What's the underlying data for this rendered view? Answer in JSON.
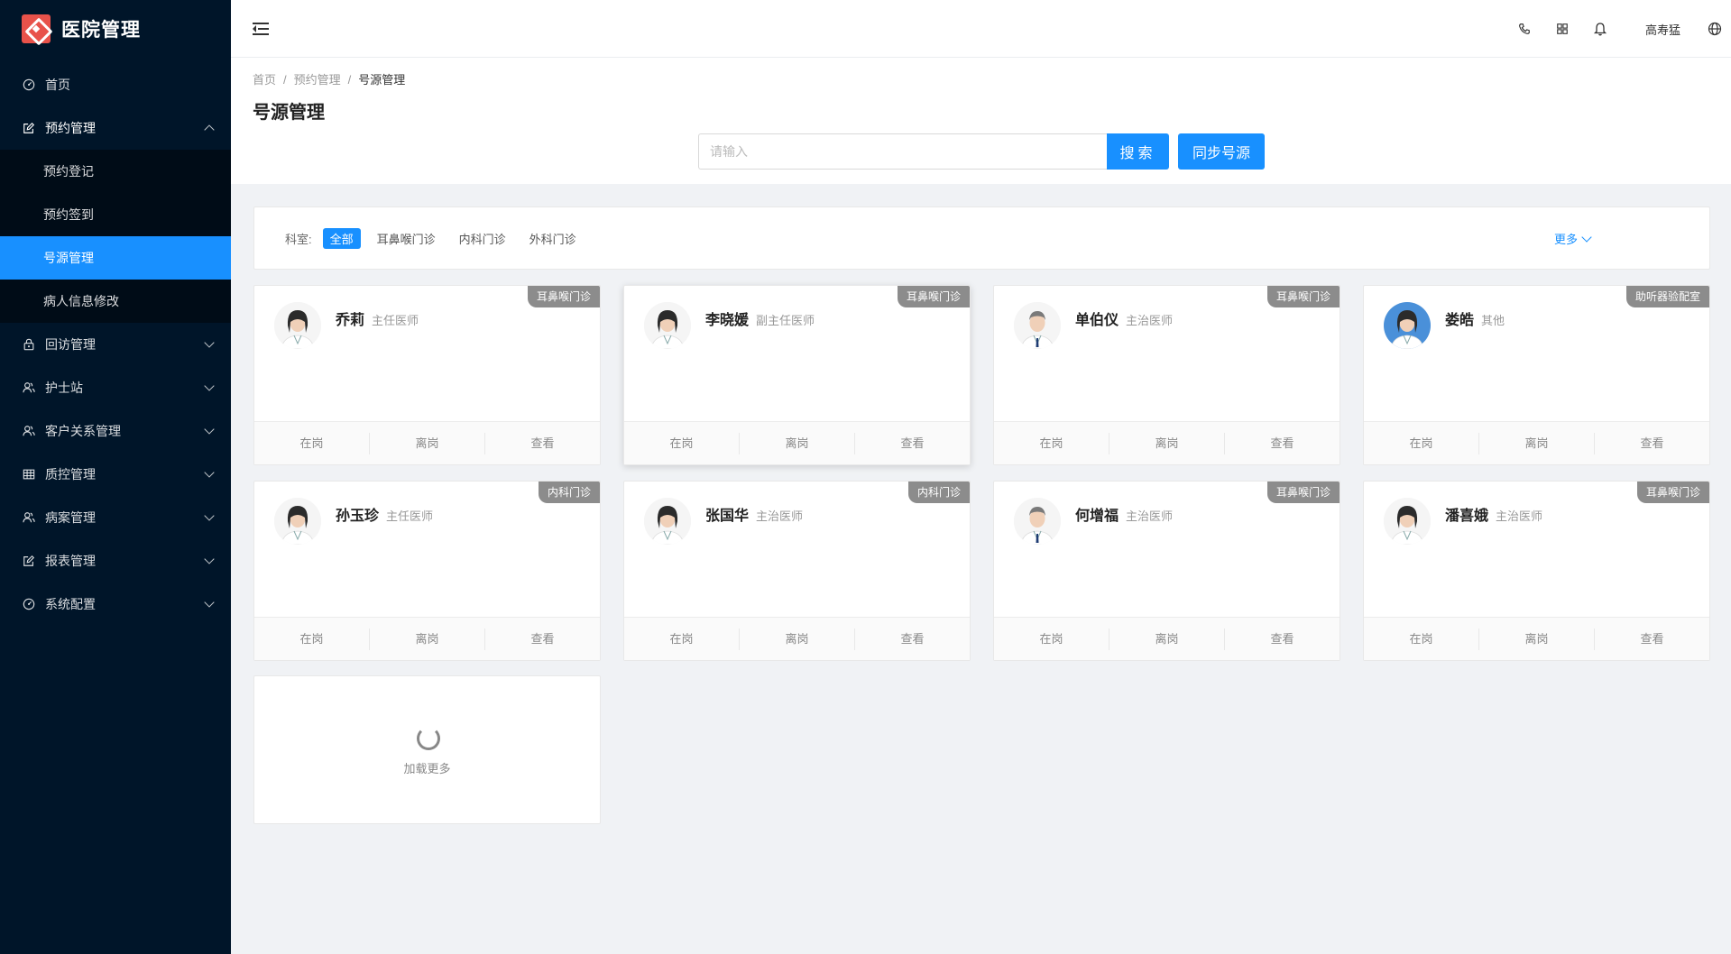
{
  "app": {
    "title": "医院管理"
  },
  "sidebar": {
    "items": [
      {
        "label": "首页",
        "icon": "dashboard-icon"
      },
      {
        "label": "预约管理",
        "icon": "edit-icon",
        "open": true,
        "children": [
          {
            "label": "预约登记"
          },
          {
            "label": "预约签到"
          },
          {
            "label": "号源管理",
            "active": true
          },
          {
            "label": "病人信息修改"
          }
        ]
      },
      {
        "label": "回访管理",
        "icon": "lock-icon"
      },
      {
        "label": "护士站",
        "icon": "user-group-icon"
      },
      {
        "label": "客户关系管理",
        "icon": "user-group-icon"
      },
      {
        "label": "质控管理",
        "icon": "table-icon"
      },
      {
        "label": "病案管理",
        "icon": "user-group-icon"
      },
      {
        "label": "报表管理",
        "icon": "edit-icon"
      },
      {
        "label": "系统配置",
        "icon": "dashboard-icon"
      }
    ]
  },
  "header": {
    "user": "高寿猛"
  },
  "breadcrumb": [
    "首页",
    "预约管理",
    "号源管理"
  ],
  "page": {
    "title": "号源管理"
  },
  "search": {
    "placeholder": "请输入",
    "button": "搜索",
    "sync_button": "同步号源"
  },
  "filter": {
    "label": "科室:",
    "tags": [
      "全部",
      "耳鼻喉门诊",
      "内科门诊",
      "外科门诊"
    ],
    "active": 0,
    "more": "更多"
  },
  "actions": {
    "on": "在岗",
    "off": "离岗",
    "view": "查看"
  },
  "doctors": [
    {
      "name": "乔莉",
      "title": "主任医师",
      "dept": "耳鼻喉门诊",
      "gender": "f"
    },
    {
      "name": "李晓媛",
      "title": "副主任医师",
      "dept": "耳鼻喉门诊",
      "gender": "f"
    },
    {
      "name": "单伯仪",
      "title": "主治医师",
      "dept": "耳鼻喉门诊",
      "gender": "m"
    },
    {
      "name": "娄皓",
      "title": "其他",
      "dept": "助听器验配室",
      "gender": "f",
      "bluebg": true
    },
    {
      "name": "孙玉珍",
      "title": "主任医师",
      "dept": "内科门诊",
      "gender": "f"
    },
    {
      "name": "张国华",
      "title": "主治医师",
      "dept": "内科门诊",
      "gender": "f"
    },
    {
      "name": "何增福",
      "title": "主治医师",
      "dept": "耳鼻喉门诊",
      "gender": "m"
    },
    {
      "name": "潘喜娥",
      "title": "主治医师",
      "dept": "耳鼻喉门诊",
      "gender": "f"
    }
  ],
  "loadmore": {
    "label": "加载更多"
  },
  "colors": {
    "primary": "#1890ff",
    "sidebar": "#001529",
    "submenu": "#000c17",
    "tag": "#8c8c8c",
    "logo": "#e8524a"
  }
}
